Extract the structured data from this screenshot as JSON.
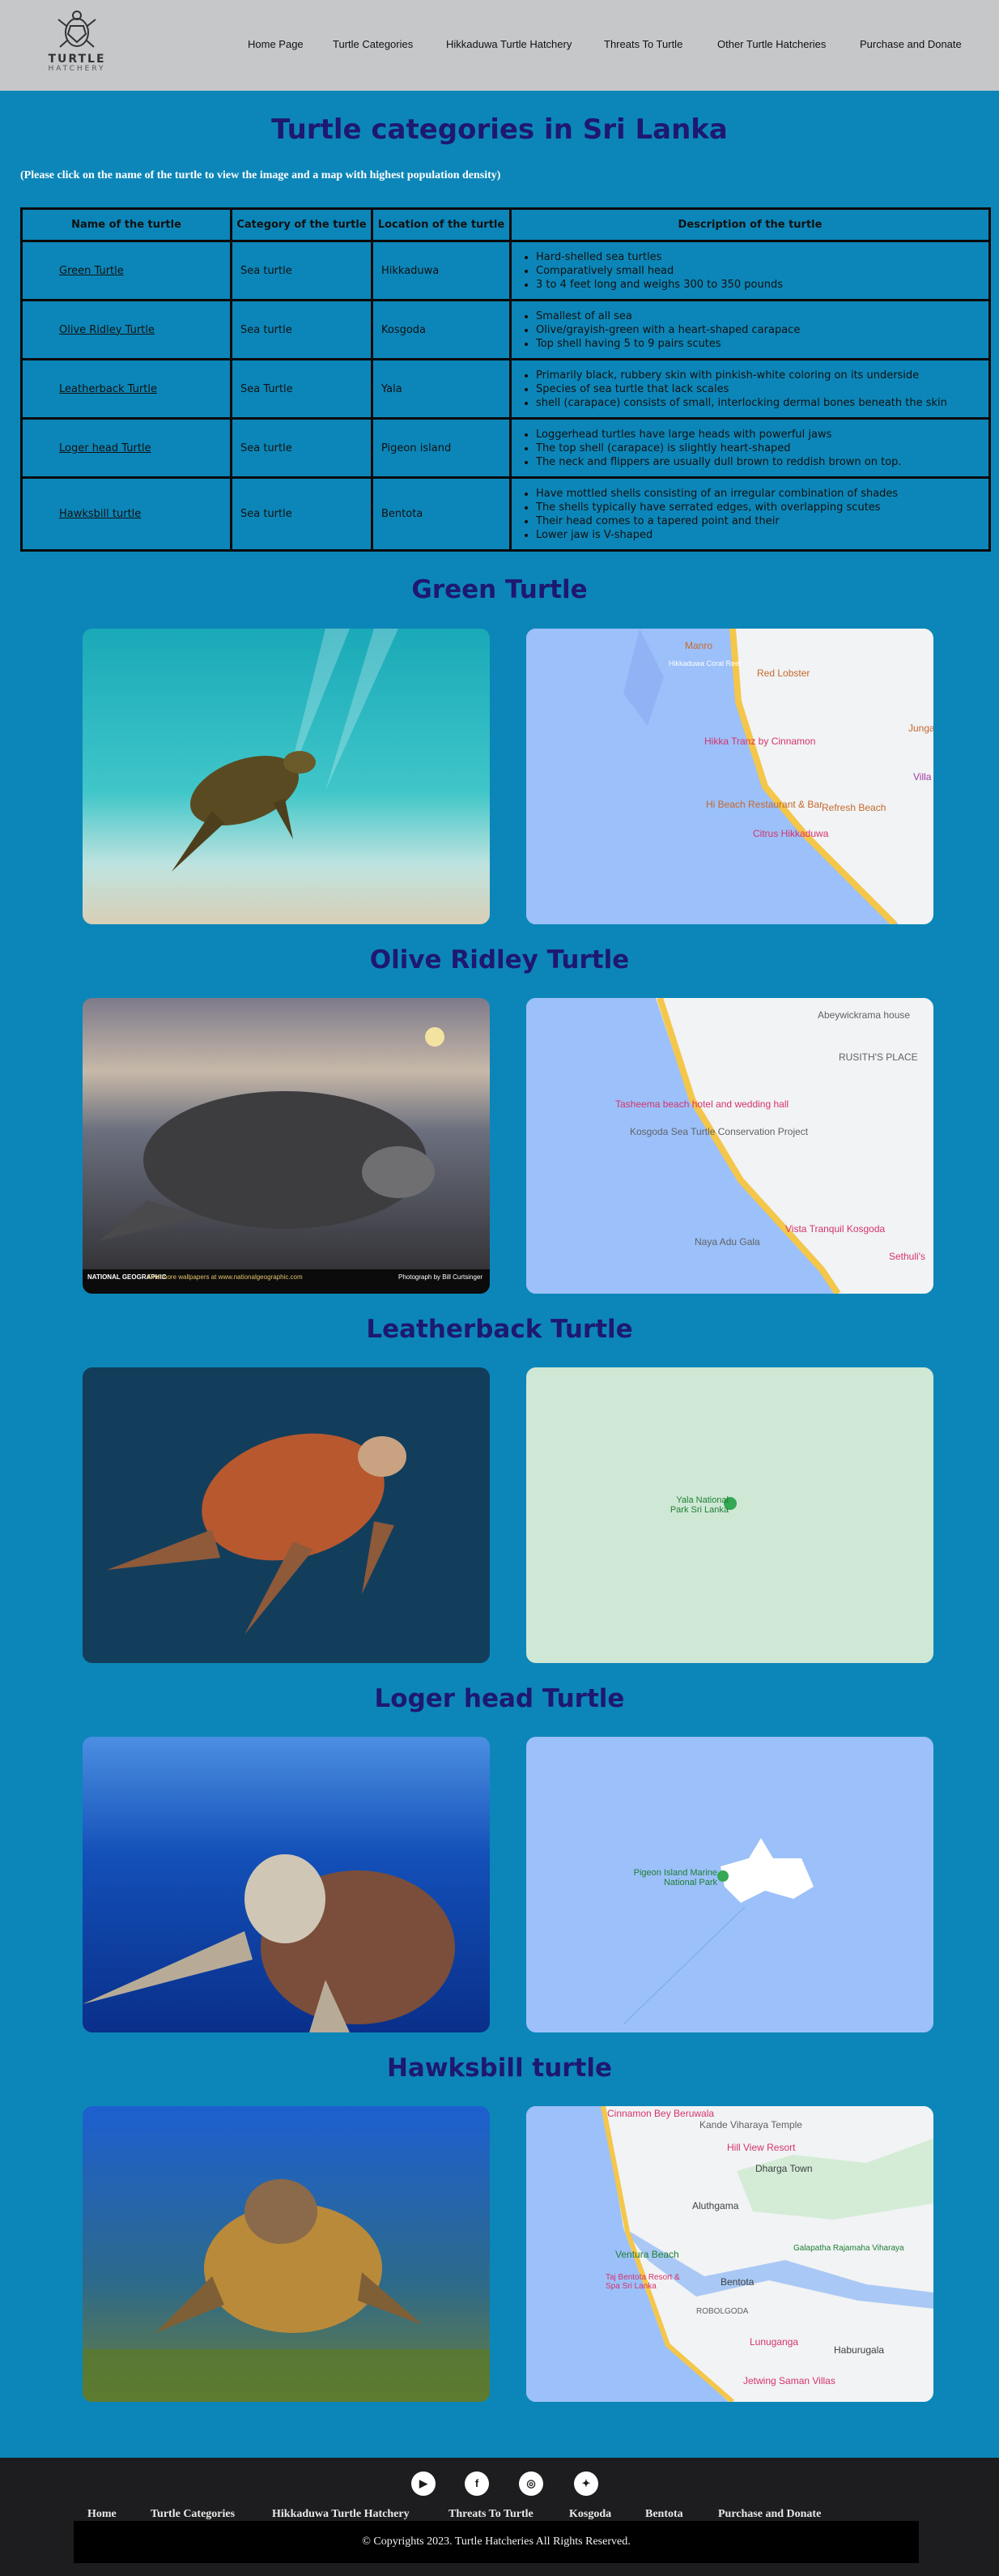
{
  "header": {
    "logo_line1": "TURTLE",
    "logo_line2": "HATCHERY",
    "nav": [
      "Home Page",
      "Turtle Categories",
      "Hikkaduwa Turtle Hatchery",
      "Threats To Turtle",
      "Other Turtle Hatcheries",
      "Purchase and Donate"
    ]
  },
  "title": "Turtle categories in Sri Lanka",
  "instruction": "(Please click on the name of the turtle to view the image and a map with highest population density)",
  "table": {
    "headers": [
      "Name of the turtle",
      "Category of the turtle",
      "Location of the turtle",
      "Description of the turtle"
    ],
    "rows": [
      {
        "name": "Green Turtle",
        "category": "Sea turtle",
        "location": "Hikkaduwa",
        "desc": [
          "Hard-shelled sea turtles",
          "Comparatively small head",
          "3 to 4 feet long and weighs 300 to 350 pounds"
        ]
      },
      {
        "name": "Olive Ridley Turtle",
        "category": "Sea turtle",
        "location": "Kosgoda",
        "desc": [
          "Smallest of all sea",
          "Olive/grayish-green with a heart-shaped carapace",
          "Top shell having 5 to 9 pairs scutes"
        ]
      },
      {
        "name": "Leatherback Turtle",
        "category": "Sea Turtle",
        "location": "Yala",
        "desc": [
          "Primarily black, rubbery skin with pinkish-white coloring on its underside",
          "Species of sea turtle that lack scales",
          "shell (carapace) consists of small, interlocking dermal bones beneath the skin"
        ]
      },
      {
        "name": "Loger head Turtle",
        "category": "Sea turtle",
        "location": "Pigeon island",
        "desc": [
          "Loggerhead turtles have large heads with powerful jaws",
          "The top shell (carapace) is slightly heart-shaped",
          "The neck and flippers are usually dull brown to reddish brown on top."
        ]
      },
      {
        "name": "Hawksbill turtle",
        "category": "Sea turtle",
        "location": "Bentota",
        "desc": [
          "Have mottled shells consisting of an irregular combination of shades",
          "The shells typically have serrated edges, with overlapping scutes",
          "Their head comes to a tapered point and their",
          "Lower jaw is V-shaped"
        ]
      }
    ]
  },
  "sections": [
    {
      "title": "Green Turtle",
      "map_labels": [
        "Manro",
        "Hikkaduwa Coral Reef",
        "Red Lobster",
        "Hikka Tranz by Cinnamon",
        "Refresh Beach",
        "Citrus Hikkaduwa",
        "Junga",
        "Villa",
        "Hi Beach Restaurant & Bar"
      ]
    },
    {
      "title": "Olive Ridley Turtle",
      "photo_caption_left": "NATIONAL GEOGRAPHIC",
      "photo_caption_mid": "Find more wallpapers at www.nationalgeographic.com",
      "photo_caption_right": "Photograph by Bill Curtsinger",
      "map_labels": [
        "Abeywickrama house",
        "RUSITH'S PLACE",
        "Tasheema beach hotel and wedding hall",
        "Kosgoda Sea Turtle Conservation Project",
        "Vista Tranquil Kosgoda",
        "Naya Adu Gala",
        "Sethuli's"
      ]
    },
    {
      "title": "Leatherback Turtle",
      "map_labels": [
        "Yala National Park Sri Lanka"
      ]
    },
    {
      "title": "Loger head Turtle",
      "map_labels": [
        "Pigeon Island Marine National Park"
      ]
    },
    {
      "title": "Hawksbill turtle",
      "map_labels": [
        "Cinnamon Bey Beruwala",
        "Kande Viharaya Temple",
        "Hill View Resort",
        "Dharga Town",
        "Aluthgama",
        "Ventura Beach",
        "Galapatha Rajamaha Viharaya",
        "Taj Bentota Resort & Spa Sri Lanka",
        "Bentota",
        "ROBOLGODA",
        "Lunuganga",
        "Haburugala",
        "Jetwing Saman Villas"
      ]
    }
  ],
  "footer": {
    "social": [
      "youtube-icon",
      "facebook-icon",
      "instagram-icon",
      "twitter-icon"
    ],
    "nav": [
      "Home",
      "Turtle Categories",
      "Hikkaduwa Turtle Hatchery",
      "Threats To Turtle",
      "Kosgoda",
      "Bentota",
      "Purchase and Donate"
    ],
    "copyright": "© Copyrights 2023. Turtle Hatcheries All Rights Reserved."
  }
}
